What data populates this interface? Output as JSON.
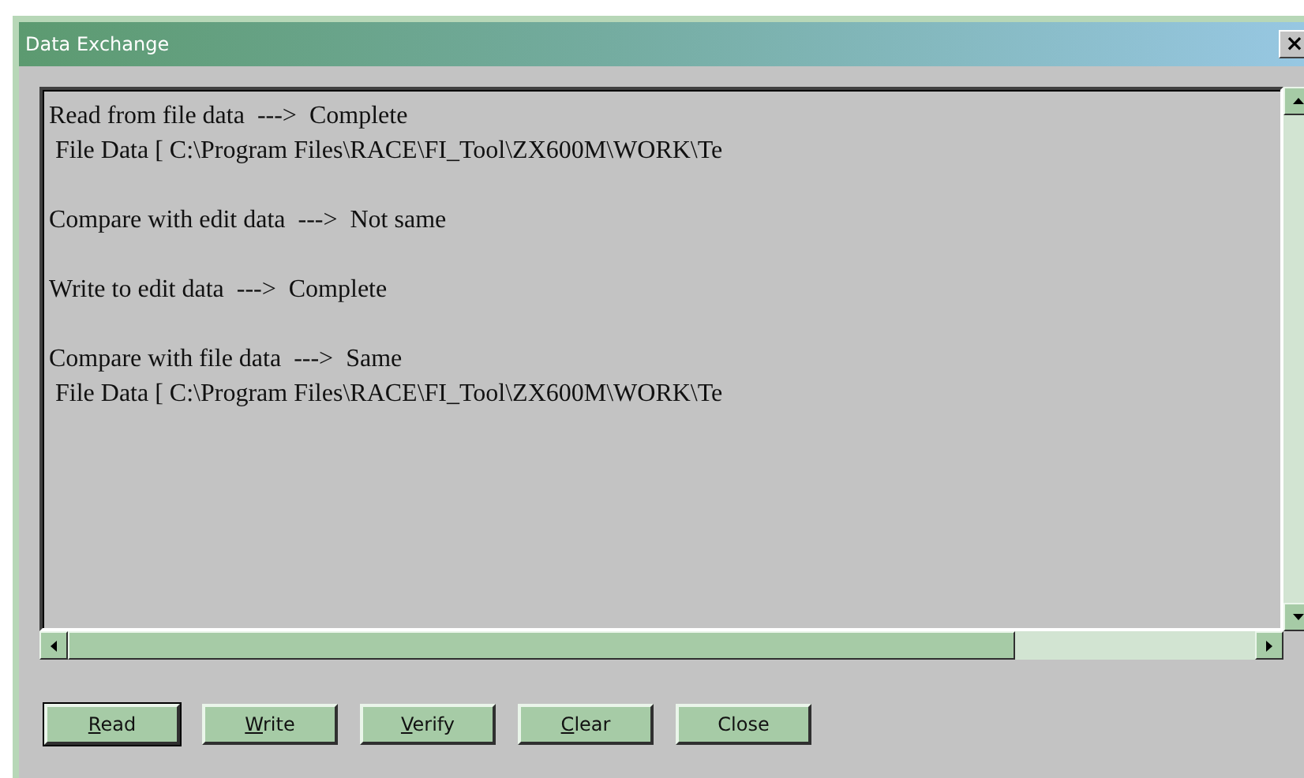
{
  "window": {
    "title": "Data Exchange",
    "close_glyph": "×"
  },
  "log": {
    "entries": [
      {
        "lines": [
          "Read from file data  --->  Complete",
          " File Data [ C:\\Program Files\\RACE\\FI_Tool\\ZX600M\\WORK\\Te"
        ]
      },
      {
        "lines": [
          "Compare with edit data  --->  Not same"
        ]
      },
      {
        "lines": [
          "Write to edit data  --->  Complete"
        ]
      },
      {
        "lines": [
          "Compare with file data  --->  Same",
          " File Data [ C:\\Program Files\\RACE\\FI_Tool\\ZX600M\\WORK\\Te"
        ]
      }
    ]
  },
  "buttons": [
    {
      "label": "Read",
      "mnemonic": true,
      "default": true
    },
    {
      "label": "Write",
      "mnemonic": true,
      "default": false
    },
    {
      "label": "Verify",
      "mnemonic": true,
      "default": false
    },
    {
      "label": "Clear",
      "mnemonic": true,
      "default": false
    },
    {
      "label": "Close",
      "mnemonic": false,
      "default": false
    }
  ]
}
